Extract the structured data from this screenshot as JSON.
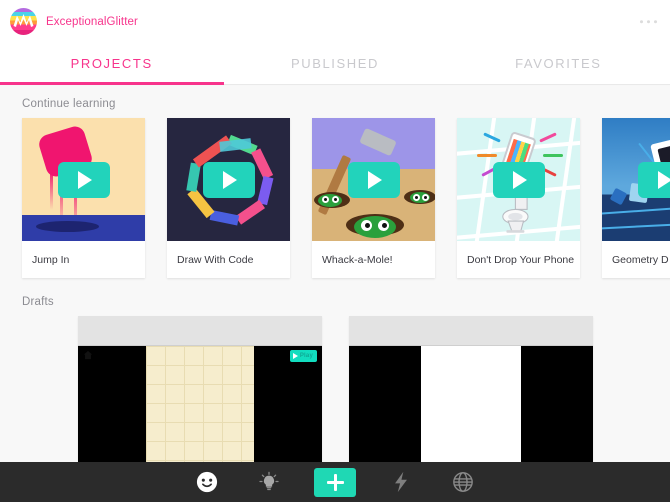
{
  "app": {
    "brand_name": "ExceptionalGlitter",
    "logo_icon": "rainbow-circle-logo",
    "overflow_icon": "more-options-icon"
  },
  "tabs": [
    {
      "label": "PROJECTS",
      "active": true
    },
    {
      "label": "PUBLISHED",
      "active": false
    },
    {
      "label": "FAVORITES",
      "active": false
    }
  ],
  "sections": {
    "continue_learning": {
      "label": "Continue learning",
      "cards": [
        {
          "title": "Jump In",
          "art": "jump",
          "play_icon": "play-icon"
        },
        {
          "title": "Draw With Code",
          "art": "draw",
          "play_icon": "play-icon"
        },
        {
          "title": "Whack-a-Mole!",
          "art": "whack",
          "play_icon": "play-icon"
        },
        {
          "title": "Don't Drop Your Phone",
          "art": "phone",
          "play_icon": "play-icon"
        },
        {
          "title": "Geometry D",
          "art": "geo",
          "play_icon": "play-icon"
        }
      ]
    },
    "drafts": {
      "label": "Drafts",
      "items": [
        {
          "canvas": "cream",
          "play_badge_label": "Play",
          "home_icon": "home-icon"
        },
        {
          "canvas": "white",
          "play_badge_label": "",
          "home_icon": ""
        }
      ]
    }
  },
  "toolbar": {
    "items": [
      {
        "icon": "smiley-face-icon",
        "label": "Profile"
      },
      {
        "icon": "lightbulb-icon",
        "label": "Ideas"
      },
      {
        "icon": "plus-icon",
        "label": "New Project"
      },
      {
        "icon": "lightning-bolt-icon",
        "label": "Challenges"
      },
      {
        "icon": "globe-icon",
        "label": "Community"
      }
    ]
  },
  "colors": {
    "accent_pink": "#f7348c",
    "accent_teal": "#22d3bb",
    "toolbar_bg": "#2b2b2b",
    "page_bg": "#f8f8f8"
  }
}
